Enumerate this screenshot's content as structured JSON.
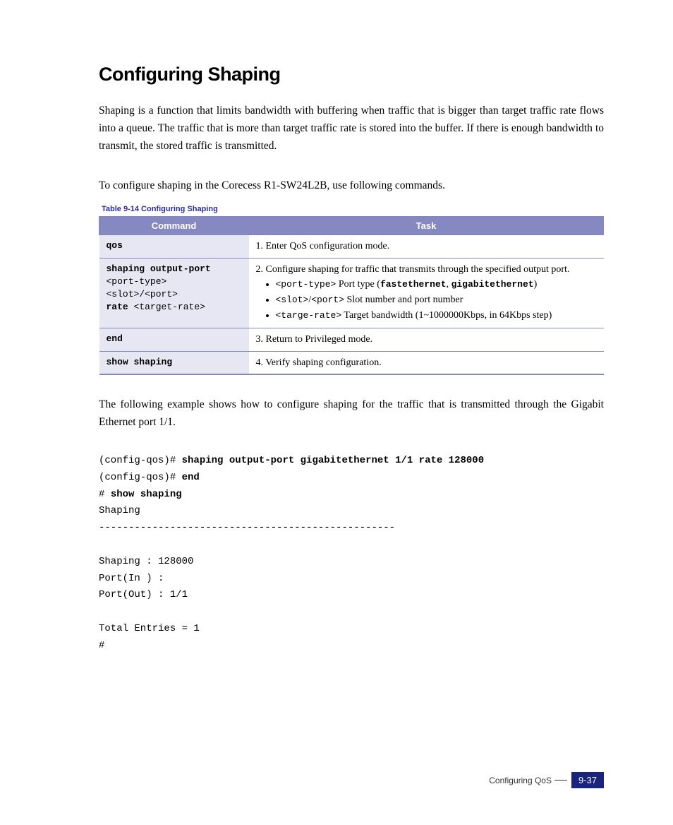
{
  "title": "Configuring Shaping",
  "para1": "Shaping is a function that limits bandwidth with buffering when traffic that is bigger than target traffic rate flows into a queue. The traffic that is more than target traffic rate is stored into the buffer. If there is enough bandwidth to transmit, the stored traffic is transmitted.",
  "para2": "To configure shaping in the Corecess R1-SW24L2B, use following commands.",
  "tablecaption": "Table 9-14   Configuring Shaping",
  "headers": {
    "col1": "Command",
    "col2": "Task"
  },
  "rows": {
    "r1": {
      "cmd": "qos",
      "task": "1. Enter QoS configuration mode."
    },
    "r2": {
      "cmd_l1b": "shaping output-port",
      "cmd_l2": "<port-type>",
      "cmd_l3a": "<slot>",
      "cmd_l3slash": "/",
      "cmd_l3b": "<port>",
      "cmd_l4a": "rate ",
      "cmd_l4b": "<target-rate>",
      "task_lead": "2. Configure shaping for traffic that transmits through the specified output port.",
      "b1_code": "<port-type>",
      "b1_text": " Port type (",
      "b1_opt1": "fastethernet",
      "b1_sep": ", ",
      "b1_opt2": "gigabitethernet",
      "b1_close": ")",
      "b2_code1": "<slot>",
      "b2_slash": "/",
      "b2_code2": "<port>",
      "b2_text": " Slot number and port number",
      "b3_code": "<targe-rate>",
      "b3_text": " Target bandwidth (1~1000000Kbps, in 64Kbps step)"
    },
    "r3": {
      "cmd": "end",
      "task": "3. Return to Privileged mode."
    },
    "r4": {
      "cmd": "show shaping",
      "task": "4. Verify shaping configuration."
    }
  },
  "para3": "The following example shows how to configure shaping for the traffic that is transmitted through the Gigabit Ethernet port 1/1.",
  "example": {
    "l1p": "(config-qos)# ",
    "l1b": "shaping output-port gigabitethernet 1/1 rate 128000",
    "l2p": "(config-qos)# ",
    "l2b": "end",
    "l3p": "# ",
    "l3b": "show shaping",
    "l4": "Shaping",
    "l5": "--------------------------------------------------",
    "l6": "Shaping          : 128000",
    "l7": "Port(In )        :",
    "l8": "Port(Out)        : 1/1",
    "l9": "Total Entries = 1",
    "l10": "#"
  },
  "footer": {
    "section": "Configuring QoS",
    "page": "9-37"
  }
}
